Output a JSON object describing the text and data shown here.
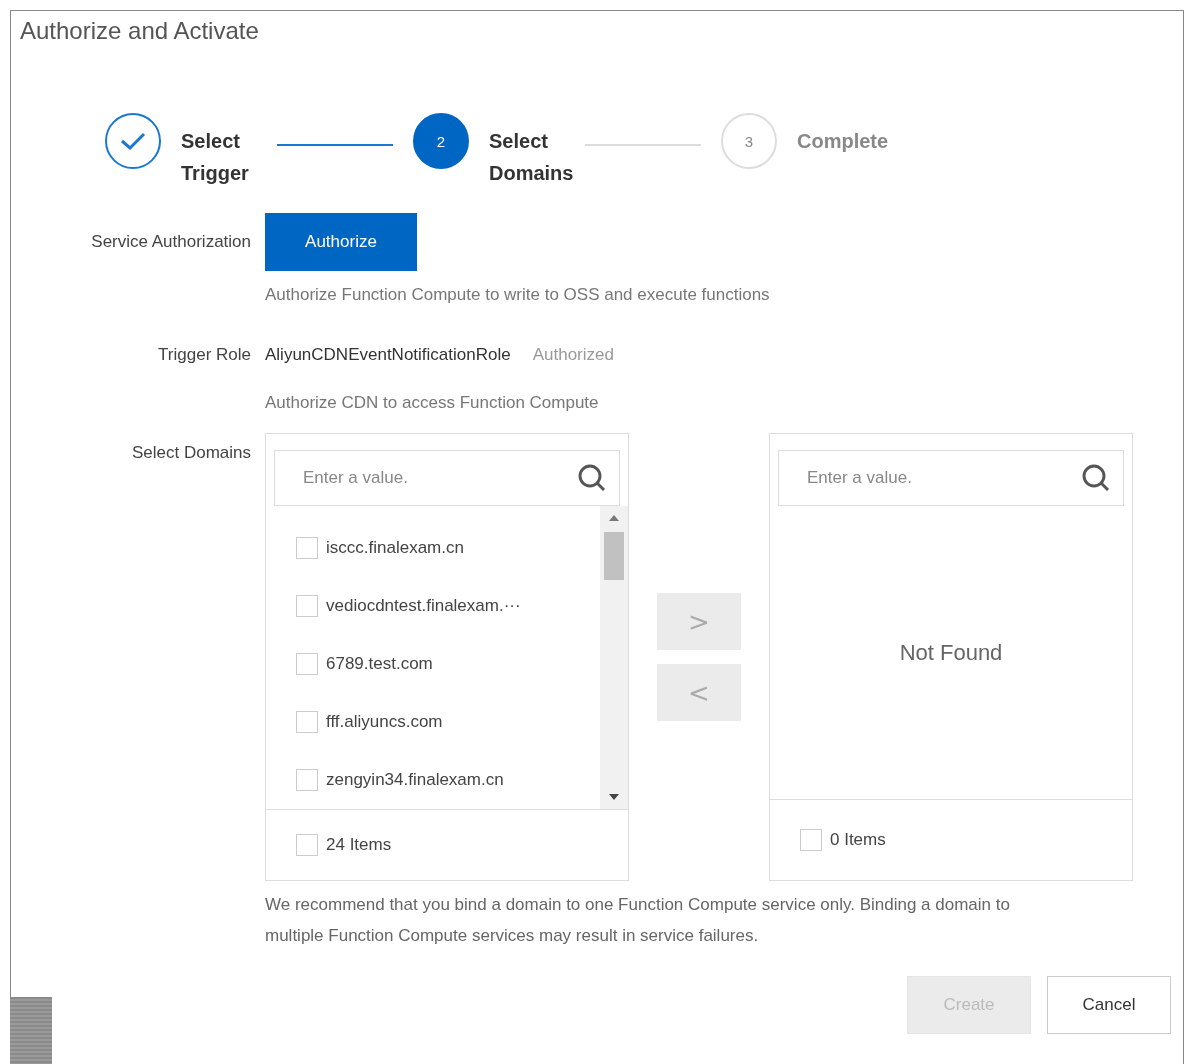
{
  "dialog": {
    "title": "Authorize and Activate"
  },
  "steps": [
    {
      "label": "Select Trigger",
      "done": true,
      "selected": false
    },
    {
      "number": "2",
      "label": "Select Domains",
      "done": false,
      "selected": true
    },
    {
      "number": "3",
      "label": "Complete",
      "done": false,
      "selected": false
    }
  ],
  "service_authorization": {
    "label": "Service Authorization",
    "button": "Authorize",
    "hint": "Authorize Function Compute to write to OSS and execute functions"
  },
  "trigger_role": {
    "label": "Trigger Role",
    "value": "AliyunCDNEventNotificationRole",
    "status": "Authorized",
    "hint": "Authorize CDN to access Function Compute"
  },
  "select_domains": {
    "label": "Select Domains",
    "source": {
      "placeholder": "Enter a value.",
      "items": [
        {
          "label": "isccc.finalexam.cn",
          "checked": false
        },
        {
          "label": "vediocdntest.finalexam.···",
          "checked": false
        },
        {
          "label": "6789.test.com",
          "checked": false
        },
        {
          "label": "fff.aliyuncs.com",
          "checked": false
        },
        {
          "label": "zengyin34.finalexam.cn",
          "checked": false
        }
      ],
      "footer": "24 Items",
      "all_checked": false
    },
    "move_right": ">",
    "move_left": "<",
    "target": {
      "placeholder": "Enter a value.",
      "empty": "Not Found",
      "footer": "0 Items",
      "all_checked": false
    },
    "note": "We recommend that you bind a domain to one Function Compute service only. Binding a domain to multiple Function Compute services may result in service failures."
  },
  "footer_buttons": [
    {
      "label": "Create",
      "disabled": true
    },
    {
      "label": "Cancel",
      "disabled": false
    }
  ]
}
